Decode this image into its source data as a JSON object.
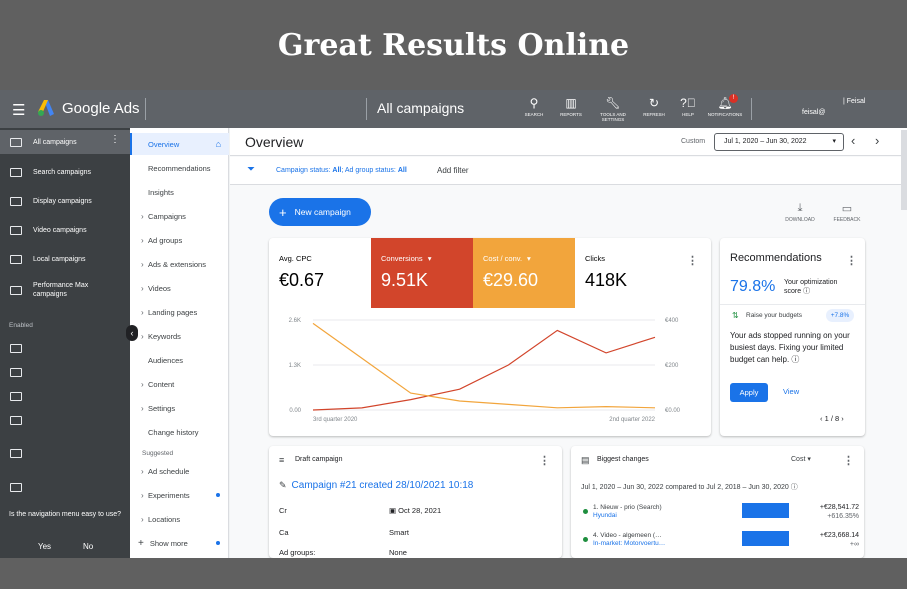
{
  "headline": "Great Results Online",
  "topbar": {
    "brand": "Google Ads",
    "campaign_title": "All campaigns",
    "tools": [
      {
        "label": "SEARCH",
        "icon": "search-icon"
      },
      {
        "label": "REPORTS",
        "icon": "reports-icon"
      },
      {
        "label": "TOOLS AND SETTINGS",
        "icon": "wrench-icon"
      },
      {
        "label": "REFRESH",
        "icon": "refresh-icon"
      },
      {
        "label": "HELP",
        "icon": "help-icon"
      },
      {
        "label": "NOTIFICATIONS",
        "icon": "bell-icon"
      }
    ],
    "notification_badge": "!",
    "user_line1": "| Feisal",
    "user_line2": "feisal@"
  },
  "leftnav": {
    "items": [
      {
        "label": "All campaigns",
        "icon": "grid-icon"
      },
      {
        "label": "Search campaigns",
        "icon": "search-campaign-icon"
      },
      {
        "label": "Display campaigns",
        "icon": "display-icon"
      },
      {
        "label": "Video campaigns",
        "icon": "video-icon"
      },
      {
        "label": "Local campaigns",
        "icon": "location-icon"
      },
      {
        "label": "Performance Max campaigns",
        "icon": "performance-icon"
      }
    ],
    "enabled_label": "Enabled",
    "question": "Is the navigation menu easy to use?",
    "yes": "Yes",
    "no": "No"
  },
  "subnav": {
    "items": [
      "Overview",
      "Recommendations",
      "Insights",
      "Campaigns",
      "Ad groups",
      "Ads & extensions",
      "Videos",
      "Landing pages",
      "Keywords",
      "Audiences",
      "Content",
      "Settings",
      "Change history"
    ],
    "suggested_label": "Suggested",
    "suggested_items": [
      "Ad schedule",
      "Experiments",
      "Locations"
    ],
    "show_more": "Show more"
  },
  "main": {
    "title": "Overview",
    "custom_label": "Custom",
    "date_range": "Jul 1, 2020 – Jun 30, 2022",
    "filter_prefix": "Campaign status: ",
    "filter_status": "All",
    "filter_mid": "; Ad group status: ",
    "filter_ad_status": "All",
    "add_filter": "Add filter",
    "new_campaign": "New campaign",
    "download": "DOWNLOAD",
    "feedback": "FEEDBACK"
  },
  "metrics": [
    {
      "label": "Avg. CPC",
      "value": "€0.67",
      "color": "#ffffff",
      "text_color": "#202124",
      "dropdown": false
    },
    {
      "label": "Conversions",
      "value": "9.51K",
      "color": "#d2452b",
      "text_color": "#ffffff",
      "dropdown": true
    },
    {
      "label": "Cost / conv.",
      "value": "€29.60",
      "color": "#f2a53c",
      "text_color": "#ffffff",
      "dropdown": true
    },
    {
      "label": "Clicks",
      "value": "418K",
      "color": "#ffffff",
      "text_color": "#202124",
      "dropdown": false
    }
  ],
  "chart_data": {
    "type": "line",
    "x_labels": [
      "3rd quarter 2020",
      "2nd quarter 2022"
    ],
    "y_left_ticks": [
      "2.6K",
      "1.3K",
      "0.00"
    ],
    "y_right_ticks": [
      "€400",
      "€200",
      "€0.00"
    ],
    "ylim_left": [
      0,
      2600
    ],
    "ylim_right": [
      0,
      400
    ],
    "x": [
      0,
      1,
      2,
      3,
      4,
      5,
      6,
      7
    ],
    "series": [
      {
        "name": "Conversions",
        "color": "#d2452b",
        "axis": "left",
        "values": [
          0,
          60,
          300,
          600,
          1300,
          2300,
          1650,
          2100
        ]
      },
      {
        "name": "Cost / conv.",
        "color": "#f2a53c",
        "axis": "right",
        "values": [
          385,
          230,
          75,
          40,
          25,
          10,
          15,
          10
        ]
      }
    ]
  },
  "recommendations": {
    "title": "Recommendations",
    "score": "79.8%",
    "score_label": "Your optimization score",
    "raise_label": "Raise your budgets",
    "raise_pill": "+7.8%",
    "body": "Your ads stopped running on your busiest days. Fixing your limited budget can help.",
    "apply": "Apply",
    "view": "View",
    "pager": "1 / 8"
  },
  "draft": {
    "title": "Draft campaign",
    "link": "Campaign #21 created 28/10/2021 10:18",
    "row1_label": "Cr",
    "row1_value": "Oct 28, 2021",
    "row2_label": "Ca",
    "row2_value": "Smart",
    "row3_label": "Ad groups:",
    "row3_value": "None"
  },
  "biggest": {
    "title": "Biggest changes",
    "cost_label": "Cost",
    "subtitle": "Jul 1, 2020 – Jun 30, 2022 compared to Jul 2, 2018 – Jun 30, 2020",
    "rows": [
      {
        "name": "1. Nieuw - prio (Search)",
        "sub": "Hyundai",
        "value": "+€28,541.72",
        "change": "+616.35%"
      },
      {
        "name": "4. Video - algemeen (…",
        "sub": "In-market: Motorvoertu…",
        "value": "+€23,668.14",
        "change": "+∞"
      }
    ]
  }
}
